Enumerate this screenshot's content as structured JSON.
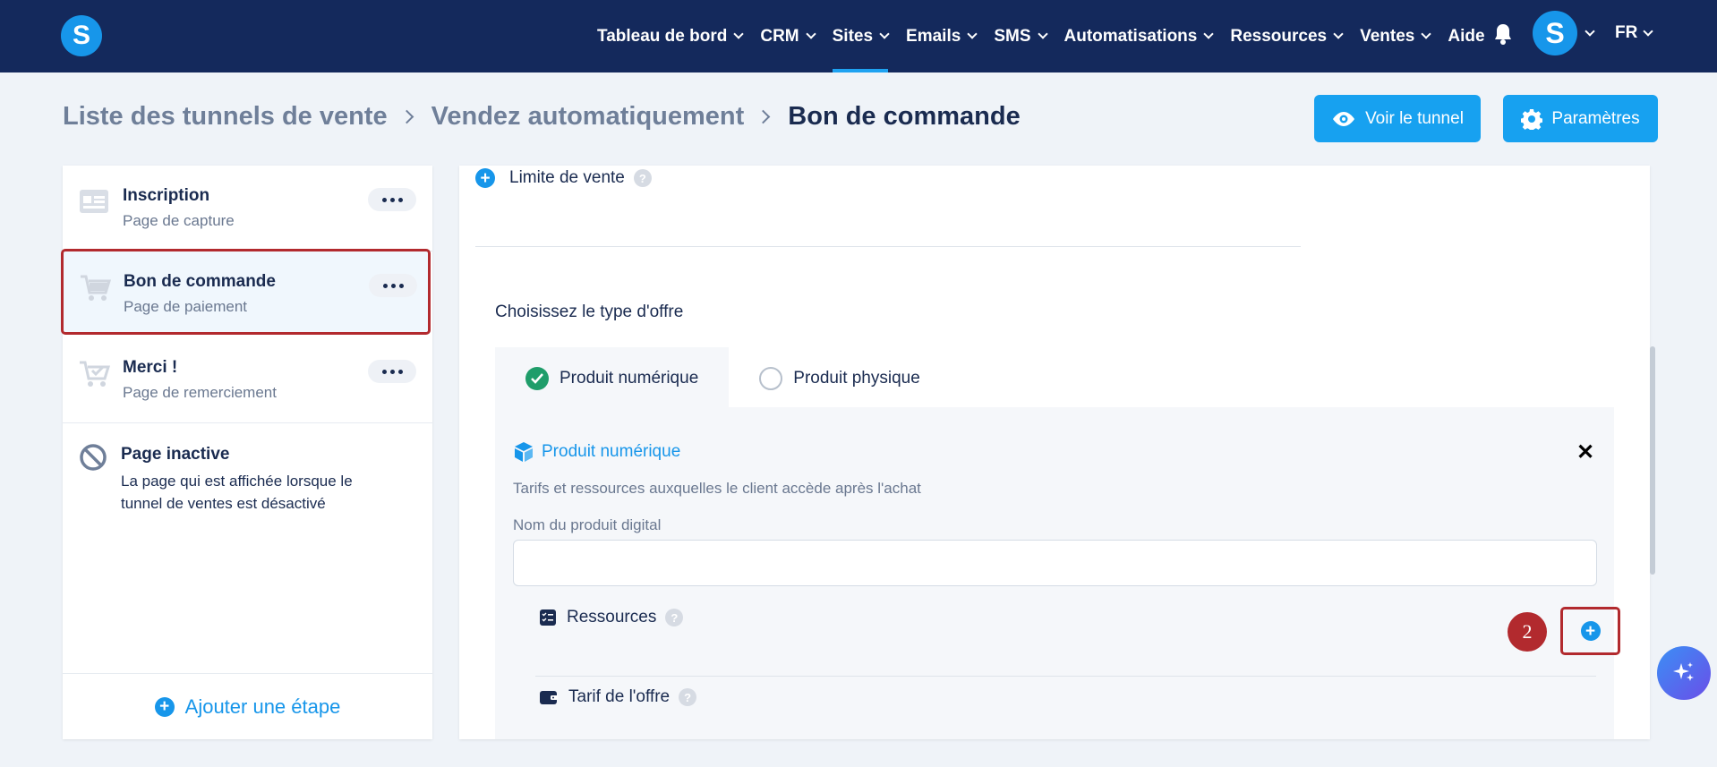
{
  "app": {
    "logo_letter": "S",
    "avatar_letter": "S",
    "language": "FR"
  },
  "nav": {
    "items": [
      {
        "label": "Tableau de bord"
      },
      {
        "label": "CRM"
      },
      {
        "label": "Sites"
      },
      {
        "label": "Emails"
      },
      {
        "label": "SMS"
      },
      {
        "label": "Automatisations"
      },
      {
        "label": "Ressources"
      },
      {
        "label": "Ventes"
      },
      {
        "label": "Aide"
      }
    ],
    "active": "Sites"
  },
  "breadcrumb": {
    "items": [
      "Liste des tunnels de vente",
      "Vendez automatiquement",
      "Bon de commande"
    ]
  },
  "header_buttons": {
    "view": "Voir le tunnel",
    "settings": "Paramètres"
  },
  "steps": [
    {
      "title": "Inscription",
      "subtitle": "Page de capture",
      "icon": "form-page-icon"
    },
    {
      "title": "Bon de commande",
      "subtitle": "Page de paiement",
      "icon": "cart-icon",
      "selected": true
    },
    {
      "title": "Merci !",
      "subtitle": "Page de remerciement",
      "icon": "cart-check-icon"
    }
  ],
  "inactive_page": {
    "title": "Page inactive",
    "description": "La page qui est affichée lorsque le tunnel de ventes est désactivé"
  },
  "add_step": "Ajouter une étape",
  "main": {
    "sale_limit": "Limite de vente",
    "offer_question": "Choisissez le type d'offre",
    "tabs": [
      {
        "label": "Produit numérique",
        "selected": true
      },
      {
        "label": "Produit physique",
        "selected": false
      }
    ],
    "offer": {
      "title": "Produit numérique",
      "description": "Tarifs et ressources auxquelles le client accède après l'achat",
      "name_label": "Nom du produit digital",
      "name_value": "",
      "resources_label": "Ressources",
      "step_badge": "2",
      "tarif_label": "Tarif de l'offre"
    }
  },
  "colors": {
    "nav_bg": "#14295c",
    "accent": "#17a1f0",
    "highlight": "#b22a2e",
    "success": "#1f9d6a"
  }
}
